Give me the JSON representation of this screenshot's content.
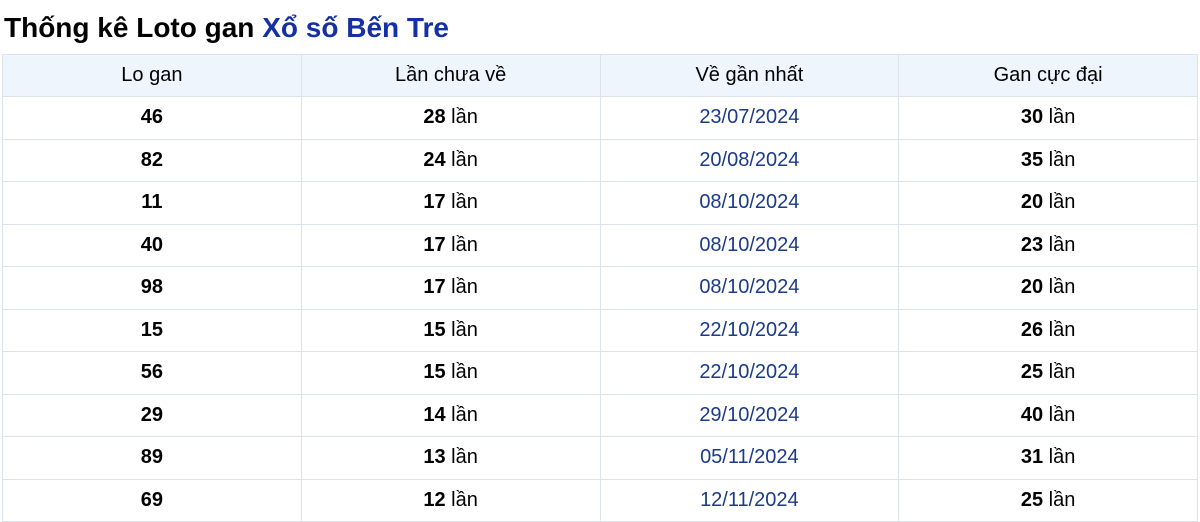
{
  "heading": {
    "prefix": "Thống kê Loto gan ",
    "accent": "Xổ số Bến Tre"
  },
  "colors": {
    "accent": "#1530a3",
    "header_bg": "#eef5fc",
    "date_text": "#1a3a8a",
    "border": "#dde3ea"
  },
  "table": {
    "headers": [
      "Lo gan",
      "Lần chưa về",
      "Về gần nhất",
      "Gan cực đại"
    ],
    "unit": "lần",
    "rows": [
      {
        "lo": "46",
        "chua_ve": "28",
        "gan_nhat": "23/07/2024",
        "cuc_dai": "30"
      },
      {
        "lo": "82",
        "chua_ve": "24",
        "gan_nhat": "20/08/2024",
        "cuc_dai": "35"
      },
      {
        "lo": "11",
        "chua_ve": "17",
        "gan_nhat": "08/10/2024",
        "cuc_dai": "20"
      },
      {
        "lo": "40",
        "chua_ve": "17",
        "gan_nhat": "08/10/2024",
        "cuc_dai": "23"
      },
      {
        "lo": "98",
        "chua_ve": "17",
        "gan_nhat": "08/10/2024",
        "cuc_dai": "20"
      },
      {
        "lo": "15",
        "chua_ve": "15",
        "gan_nhat": "22/10/2024",
        "cuc_dai": "26"
      },
      {
        "lo": "56",
        "chua_ve": "15",
        "gan_nhat": "22/10/2024",
        "cuc_dai": "25"
      },
      {
        "lo": "29",
        "chua_ve": "14",
        "gan_nhat": "29/10/2024",
        "cuc_dai": "40"
      },
      {
        "lo": "89",
        "chua_ve": "13",
        "gan_nhat": "05/11/2024",
        "cuc_dai": "31"
      },
      {
        "lo": "69",
        "chua_ve": "12",
        "gan_nhat": "12/11/2024",
        "cuc_dai": "25"
      }
    ]
  }
}
